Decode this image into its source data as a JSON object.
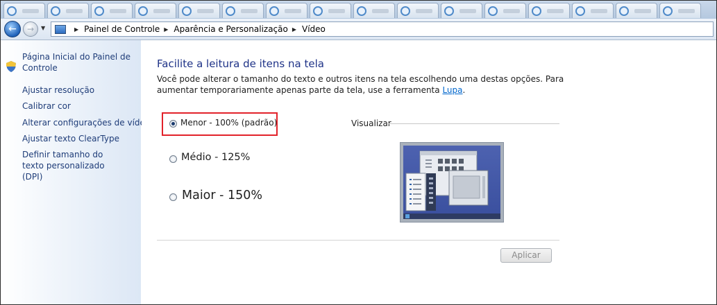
{
  "window": {
    "breadcrumb": [
      "Painel de Controle",
      "Aparência e Personalização",
      "Vídeo"
    ],
    "tab_count": 16
  },
  "sidebar": {
    "items": [
      {
        "label": "Página Inicial do Painel de Controle"
      },
      {
        "label": "Ajustar resolução"
      },
      {
        "label": "Calibrar cor",
        "icon": "shield-icon"
      },
      {
        "label": "Alterar configurações de vídeo"
      },
      {
        "label": "Ajustar texto ClearType"
      },
      {
        "label": "Definir tamanho do texto personalizado (DPI)"
      }
    ]
  },
  "main": {
    "title": "Facilite a leitura de itens na tela",
    "description": "Você pode alterar o tamanho do texto e outros itens na tela escolhendo uma destas opções. Para aumentar temporariamente apenas parte da tela, use a ferramenta ",
    "description_link": "Lupa",
    "description_end": ".",
    "options": [
      {
        "label": "Menor - 100% (padrão)",
        "selected": true
      },
      {
        "label": "Médio - 125%",
        "selected": false
      },
      {
        "label": "Maior - 150%",
        "selected": false
      }
    ],
    "preview_label": "Visualizar",
    "apply_label": "Aplicar"
  },
  "colors": {
    "highlight_box": "#e2222a",
    "link": "#0066cc",
    "title": "#1e3287"
  }
}
